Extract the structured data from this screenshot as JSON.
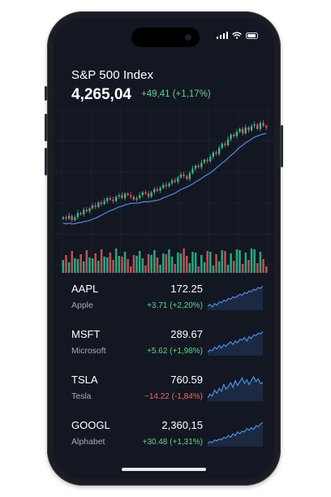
{
  "index": {
    "title": "S&P 500 Index",
    "price": "4,265,04",
    "change": "+49,41 (+1,17%)"
  },
  "colors": {
    "up": "#2fbf8f",
    "down": "#e05a5a",
    "line": "#4a8fe6",
    "bg": "#131722"
  },
  "icons": [
    "signal-icon",
    "wifi-icon",
    "battery-icon"
  ],
  "stocks": [
    {
      "symbol": "AAPL",
      "name": "Apple",
      "price": "172.25",
      "change": "+3.71 (+2,20%)",
      "direction": "up"
    },
    {
      "symbol": "MSFT",
      "name": "Microsoft",
      "price": "289.67",
      "change": "+5.62 (+1,98%)",
      "direction": "up"
    },
    {
      "symbol": "TSLA",
      "name": "Tesla",
      "price": "760.59",
      "change": "−14.22 (-1,84%)",
      "direction": "down"
    },
    {
      "symbol": "GOOGL",
      "name": "Alphabet",
      "price": "2,360,15",
      "change": "+30.48 (+1,31%)",
      "direction": "up"
    }
  ],
  "chart_data": {
    "type": "candlestick",
    "title": "",
    "close": [
      35,
      34,
      36,
      33,
      35,
      38,
      37,
      40,
      39,
      41,
      43,
      42,
      45,
      44,
      46,
      48,
      47,
      46,
      49,
      50,
      48,
      51,
      50,
      49,
      47,
      48,
      50,
      52,
      51,
      49,
      52,
      54,
      53,
      55,
      57,
      56,
      58,
      60,
      59,
      62,
      64,
      63,
      61,
      65,
      68,
      70,
      69,
      72,
      74,
      73,
      76,
      79,
      78,
      82,
      85,
      84,
      88,
      91,
      90,
      93,
      95,
      92,
      96,
      94,
      97,
      98,
      95,
      99,
      97,
      96
    ],
    "moving_average_shown": true,
    "volume_shown": true
  }
}
